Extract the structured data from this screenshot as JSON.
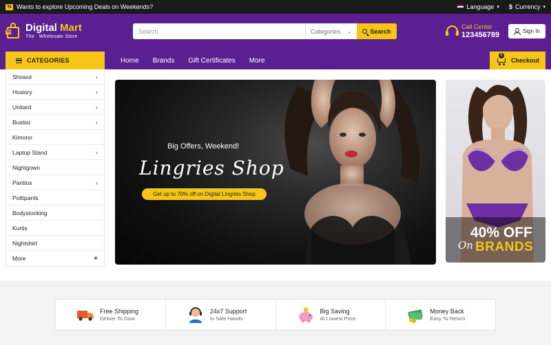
{
  "topbar": {
    "promo_badge": "%",
    "promo_text": "Wants to explore Upcoming Deals on Weekends?",
    "language": "Language",
    "currency_symbol": "$",
    "currency": "Currency"
  },
  "header": {
    "logo_name_1": "Digital",
    "logo_name_2": "Mart",
    "logo_tagline": "The   Wholesale Store",
    "logo_badge": "%",
    "search_placeholder": "Search",
    "categories_select": "Categories",
    "search_button": "Search",
    "call_label": "Call Center",
    "call_number": "123456789",
    "signin": "Sign In"
  },
  "nav": {
    "categories_label": "CATEGORIES",
    "links": [
      "Home",
      "Brands",
      "Gift Certificates",
      "More"
    ],
    "cart_count": "0",
    "checkout": "Checkout"
  },
  "sidebar": {
    "items": [
      {
        "label": "Showol",
        "arrow": "›"
      },
      {
        "label": "Hosiory",
        "arrow": "›"
      },
      {
        "label": "Unitard",
        "arrow": "›"
      },
      {
        "label": "Bustior",
        "arrow": "›"
      },
      {
        "label": "Kimono",
        "arrow": ""
      },
      {
        "label": "Laptop Stand",
        "arrow": "›"
      },
      {
        "label": "Nightgown",
        "arrow": ""
      },
      {
        "label": "Pantios",
        "arrow": "›"
      },
      {
        "label": "Pottipants",
        "arrow": ""
      },
      {
        "label": "Bodystocking",
        "arrow": ""
      },
      {
        "label": "Kurtis",
        "arrow": ""
      },
      {
        "label": "Nightshirt",
        "arrow": ""
      },
      {
        "label": "More",
        "arrow": "+"
      }
    ]
  },
  "hero": {
    "kicker": "Big Offers, Weekend!",
    "title": "Lingries Shop",
    "pill": "Get up to 70% off on Digital Lingries Shop"
  },
  "side_banner": {
    "discount": "40% OFF",
    "on": "On",
    "brands": "BRANDS"
  },
  "features": [
    {
      "title": "Free Shipping",
      "sub": "Deliver To Door",
      "icon": "truck-icon"
    },
    {
      "title": "24x7 Support",
      "sub": "In Safe Hands",
      "icon": "support-icon"
    },
    {
      "title": "Big Saving",
      "sub": "At Lowest Price",
      "icon": "piggy-bank-icon"
    },
    {
      "title": "Money Back",
      "sub": "Easy To Return",
      "icon": "money-icon"
    }
  ],
  "colors": {
    "brand_purple": "#5b1f92",
    "accent_yellow": "#f5c518",
    "topbar": "#1a1a1a"
  }
}
